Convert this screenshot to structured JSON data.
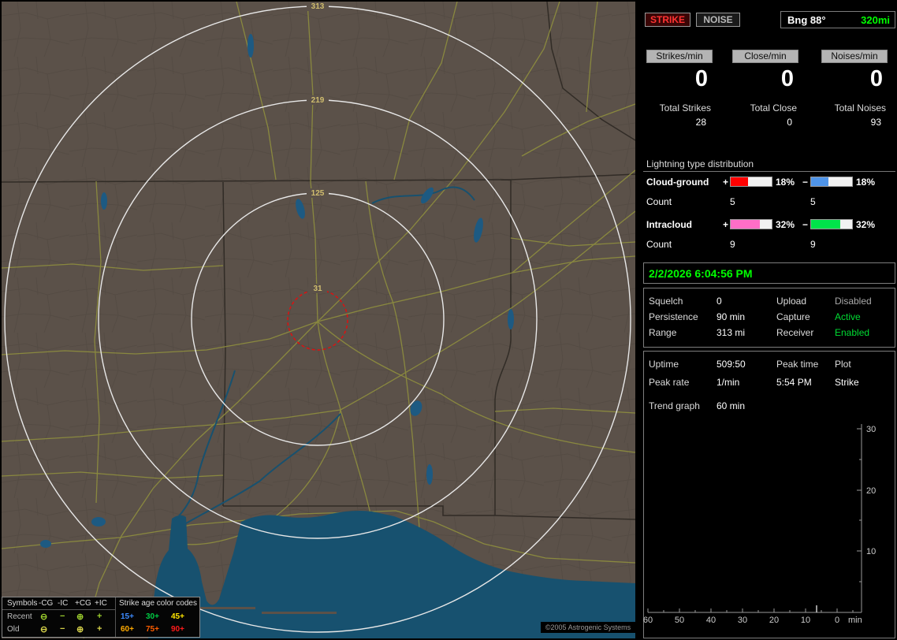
{
  "header": {
    "strike": "STRIKE",
    "noise": "NOISE",
    "bearing": "Bng 88°",
    "bearing_range": "320mi"
  },
  "counters": {
    "strikes": {
      "label": "Strikes/min",
      "value": "0",
      "total_label": "Total Strikes",
      "total": "28"
    },
    "close": {
      "label": "Close/min",
      "value": "0",
      "total_label": "Total Close",
      "total": "0"
    },
    "noises": {
      "label": "Noises/min",
      "value": "0",
      "total_label": "Total Noises",
      "total": "93"
    }
  },
  "distribution": {
    "title": "Lightning type distribution",
    "count_label": "Count",
    "cloud_ground": {
      "label": "Cloud-ground",
      "plus_sign": "+",
      "minus_sign": "−",
      "plus_pct": "18%",
      "minus_pct": "18%",
      "plus_count": "5",
      "minus_count": "5",
      "plus_color": "#ff0000",
      "minus_color": "#4f94e8",
      "plus_fill": 0.42,
      "minus_fill": 0.42
    },
    "intracloud": {
      "label": "Intracloud",
      "plus_sign": "+",
      "minus_sign": "−",
      "plus_pct": "32%",
      "minus_pct": "32%",
      "plus_count": "9",
      "minus_count": "9",
      "plus_color": "#ff6ec7",
      "minus_color": "#00e34a",
      "plus_fill": 0.72,
      "minus_fill": 0.72
    }
  },
  "clock": "2/2/2026 6:04:56 PM",
  "status": {
    "rows": [
      {
        "label1": "Squelch",
        "value1": "0",
        "label2": "Upload",
        "value2": "Disabled",
        "value2_color": "#a8a8a8"
      },
      {
        "label1": "Persistence",
        "value1": "90 min",
        "label2": "Capture",
        "value2": "Active",
        "value2_color": "#00dd33"
      },
      {
        "label1": "Range",
        "value1": "313 mi",
        "label2": "Receiver",
        "value2": "Enabled",
        "value2_color": "#00dd33"
      }
    ]
  },
  "stats": {
    "uptime_label": "Uptime",
    "uptime": "509:50",
    "peak_time_label": "Peak time",
    "plot_label": "Plot",
    "peak_rate_label": "Peak rate",
    "peak_rate": "1/min",
    "peak_time": "5:54 PM",
    "plot_type": "Strike",
    "trend_label": "Trend graph",
    "trend_window": "60 min"
  },
  "graph": {
    "y_ticks": [
      "30",
      "20",
      "10"
    ],
    "x_ticks": [
      "60",
      "50",
      "40",
      "30",
      "20",
      "10",
      "0"
    ],
    "x_unit": "min"
  },
  "map": {
    "rings": [
      {
        "label": "313"
      },
      {
        "label": "219"
      },
      {
        "label": "125"
      },
      {
        "label": "31"
      }
    ],
    "copyright": "©2005 Astrogenic Systems"
  },
  "legend": {
    "symbols_label": "Symbols",
    "type_headers": [
      "-CG",
      "-IC",
      "+CG",
      "+IC"
    ],
    "age_title": "Strike age color codes",
    "recent_label": "Recent",
    "old_label": "Old",
    "glyphs": {
      "cg_minus": "⊖",
      "ic_minus": "−",
      "cg_plus": "⊕",
      "ic_plus": "+"
    },
    "recent_glyph_color": "#9ccf2e",
    "old_glyph_color": "#d6d24a",
    "recent_ages": [
      {
        "text": "15+",
        "color": "#3d8bff"
      },
      {
        "text": "30+",
        "color": "#00cc44"
      },
      {
        "text": "45+",
        "color": "#ffe600"
      }
    ],
    "old_ages": [
      {
        "text": "60+",
        "color": "#ffaa00"
      },
      {
        "text": "75+",
        "color": "#ff5e00"
      },
      {
        "text": "90+",
        "color": "#ff1a1a"
      }
    ]
  }
}
